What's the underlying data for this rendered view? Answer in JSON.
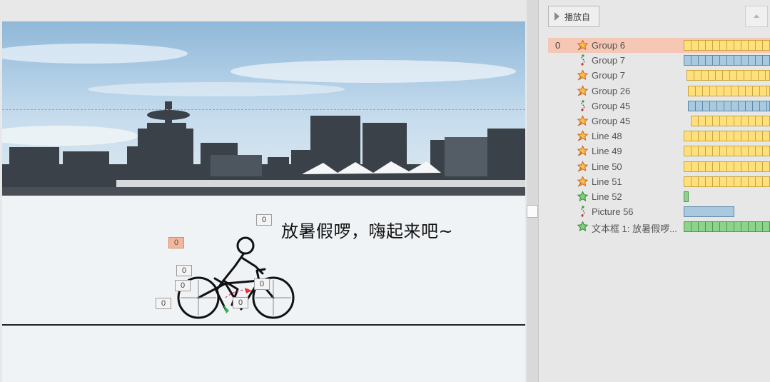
{
  "animation_pane": {
    "play_from_label": "播放自",
    "items": [
      {
        "index": "0",
        "name": "Group 6",
        "effect": "emphasis",
        "bar": "yellow",
        "selected": true
      },
      {
        "index": "",
        "name": "Group 7",
        "effect": "motion-path",
        "bar": "blue",
        "selected": false
      },
      {
        "index": "",
        "name": "Group 7",
        "effect": "emphasis",
        "bar": "yellow",
        "selected": false
      },
      {
        "index": "",
        "name": "Group 26",
        "effect": "emphasis",
        "bar": "yellow",
        "selected": false
      },
      {
        "index": "",
        "name": "Group 45",
        "effect": "motion-path",
        "bar": "blue",
        "selected": false
      },
      {
        "index": "",
        "name": "Group 45",
        "effect": "emphasis",
        "bar": "yellow",
        "selected": false
      },
      {
        "index": "",
        "name": "Line 48",
        "effect": "emphasis",
        "bar": "yellow",
        "selected": false
      },
      {
        "index": "",
        "name": "Line 49",
        "effect": "emphasis",
        "bar": "yellow",
        "selected": false
      },
      {
        "index": "",
        "name": "Line 50",
        "effect": "emphasis",
        "bar": "yellow",
        "selected": false
      },
      {
        "index": "",
        "name": "Line 51",
        "effect": "emphasis",
        "bar": "yellow",
        "selected": false
      },
      {
        "index": "",
        "name": "Line 52",
        "effect": "entrance",
        "bar": "green",
        "selected": false
      },
      {
        "index": "",
        "name": "Picture 56",
        "effect": "motion-path",
        "bar": "blue",
        "selected": false
      },
      {
        "index": "",
        "name": "文本框 1: 放暑假啰...",
        "effect": "entrance",
        "bar": "green",
        "selected": false
      }
    ]
  },
  "slide": {
    "caption": "放暑假啰，嗨起来吧~",
    "tags": {
      "selected": "0",
      "head": "0",
      "handlebar": "0",
      "rear_hub": "0",
      "front_hub": "0",
      "pedal": "0",
      "rear_wheel": "0"
    }
  },
  "colors": {
    "emphasis_bar": "#ffe07c",
    "motion_bar": "#a9c9df",
    "entrance_bar": "#8ed38b",
    "selected_row": "#f5c7b4"
  }
}
